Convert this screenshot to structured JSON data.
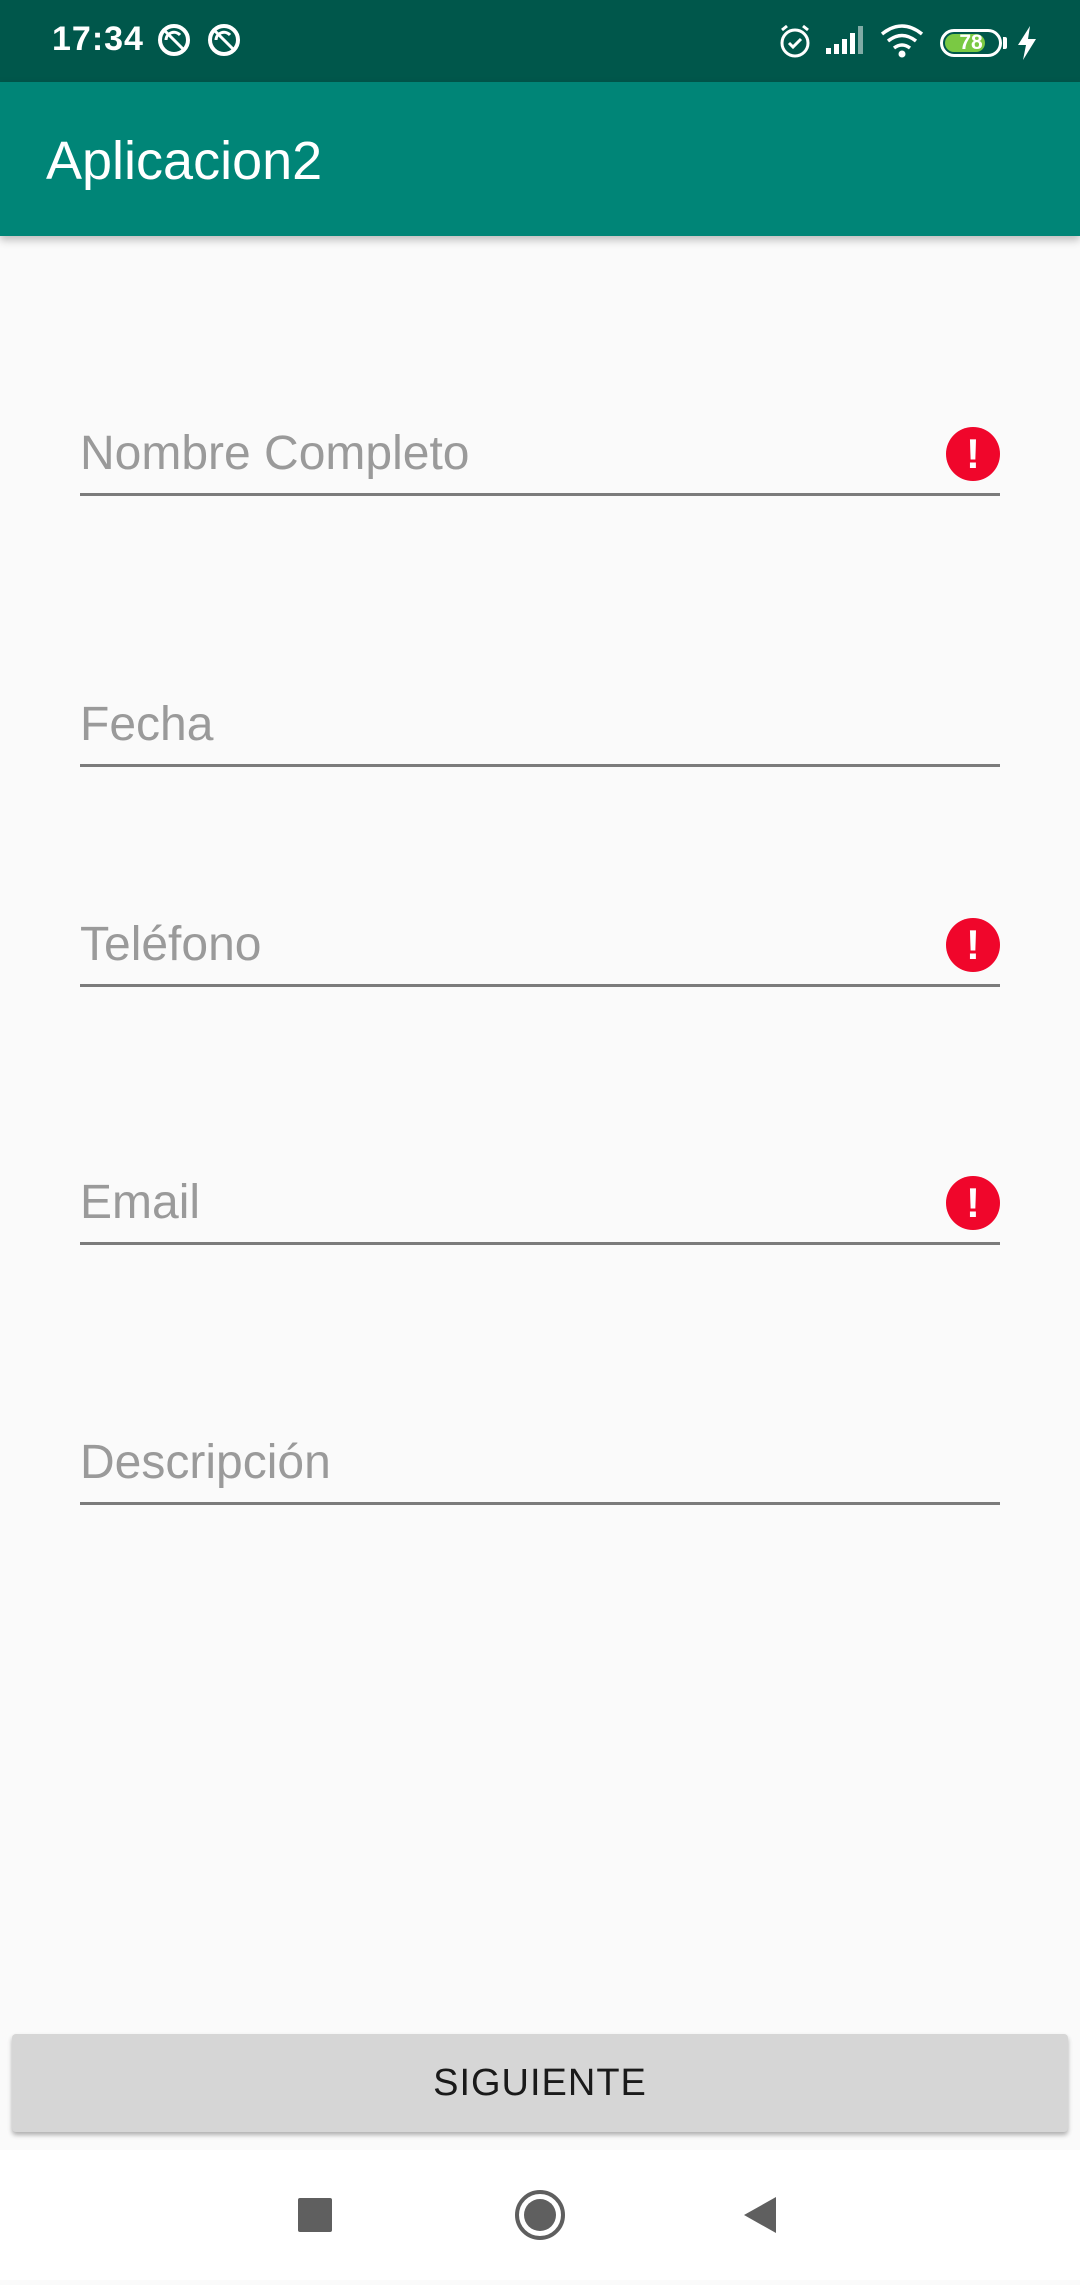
{
  "status_bar": {
    "time": "17:34",
    "battery_level": "78",
    "icons": [
      "sync-disabled-icon",
      "sync-disabled-icon",
      "alarm-icon",
      "signal-icon",
      "wifi-icon",
      "battery-icon",
      "charging-icon"
    ]
  },
  "app_bar": {
    "title": "Aplicacion2"
  },
  "form": {
    "fields": [
      {
        "placeholder": "Nombre Completo",
        "value": "",
        "error": true
      },
      {
        "placeholder": "Fecha",
        "value": "",
        "error": false
      },
      {
        "placeholder": "Teléfono",
        "value": "",
        "error": true
      },
      {
        "placeholder": "Email",
        "value": "",
        "error": true
      },
      {
        "placeholder": "Descripción",
        "value": "",
        "error": false
      }
    ],
    "error_symbol": "!"
  },
  "button": {
    "label": "SIGUIENTE"
  },
  "nav_bar": {
    "icons": [
      "recents-icon",
      "home-icon",
      "back-icon"
    ]
  },
  "colors": {
    "status_bar": "#00574b",
    "app_bar": "#008577",
    "error": "#f0062b",
    "button": "#d6d6d6",
    "background": "#fafafa"
  }
}
